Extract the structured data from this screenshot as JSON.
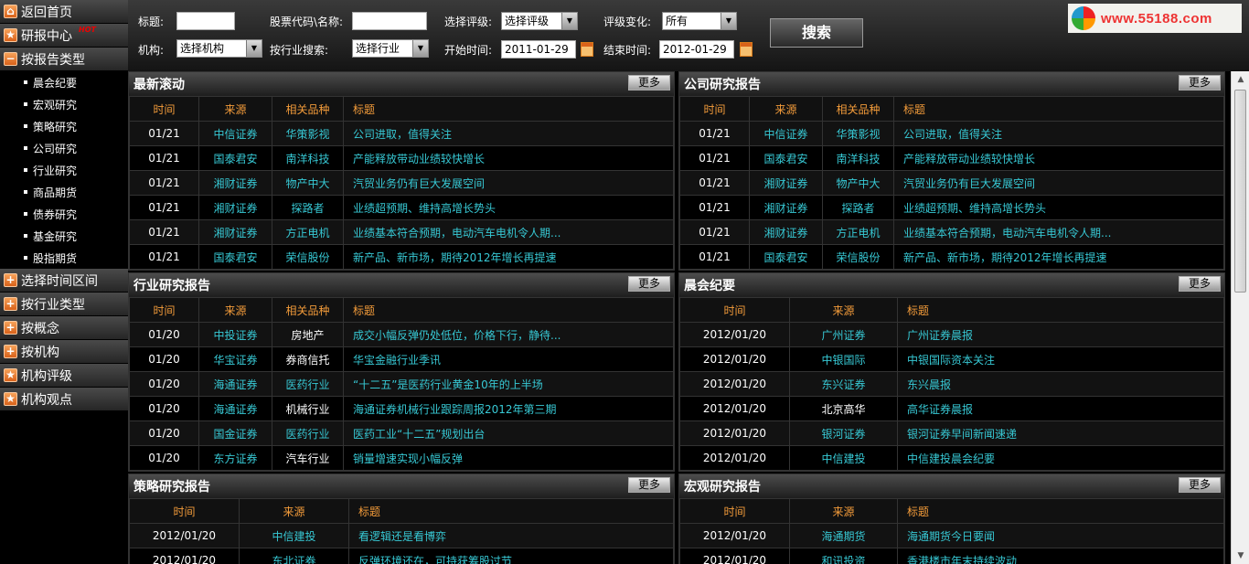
{
  "sidebar": {
    "items": [
      {
        "label": "返回首页",
        "icon": "home-icon",
        "glyph": "⌂"
      },
      {
        "label": "研报中心",
        "icon": "star-icon",
        "glyph": "★",
        "badge": "HOT"
      },
      {
        "label": "按报告类型",
        "icon": "minus-icon",
        "glyph": "−"
      }
    ],
    "sub_items": [
      "晨会纪要",
      "宏观研究",
      "策略研究",
      "公司研究",
      "行业研究",
      "商品期货",
      "债券研究",
      "基金研究",
      "股指期货"
    ],
    "items2": [
      {
        "label": "选择时间区间",
        "icon": "plus-icon",
        "glyph": "+"
      },
      {
        "label": "按行业类型",
        "icon": "plus-icon",
        "glyph": "+"
      },
      {
        "label": "按概念",
        "icon": "plus-icon",
        "glyph": "+"
      },
      {
        "label": "按机构",
        "icon": "plus-icon",
        "glyph": "+"
      },
      {
        "label": "机构评级",
        "icon": "star-icon",
        "glyph": "★"
      },
      {
        "label": "机构观点",
        "icon": "star-icon",
        "glyph": "★"
      }
    ]
  },
  "search": {
    "title_label": "标题:",
    "title_value": "",
    "code_label": "股票代码\\名称:",
    "code_value": "",
    "rating_label": "选择评级:",
    "rating_value": "选择评级",
    "change_label": "评级变化:",
    "change_value": "所有",
    "org_label": "机构:",
    "org_value": "选择机构",
    "industry_label": "按行业搜索:",
    "industry_value": "选择行业",
    "start_label": "开始时间:",
    "start_value": "2011-01-29",
    "end_label": "结束时间:",
    "end_value": "2012-01-29",
    "button": "搜索"
  },
  "logo": {
    "text": "www.55188.com"
  },
  "more_label": "更多",
  "panels": {
    "latest": {
      "title": "最新滚动",
      "headers": [
        "时间",
        "来源",
        "相关品种",
        "标题"
      ],
      "rows": [
        [
          "01/21",
          "中信证券",
          "华策影视",
          "公司进取，值得关注"
        ],
        [
          "01/21",
          "国泰君安",
          "南洋科技",
          "产能释放带动业绩较快增长"
        ],
        [
          "01/21",
          "湘财证券",
          "物产中大",
          "汽贸业务仍有巨大发展空间"
        ],
        [
          "01/21",
          "湘财证券",
          "探路者",
          "业绩超预期、维持高增长势头"
        ],
        [
          "01/21",
          "湘财证券",
          "方正电机",
          "业绩基本符合预期，电动汽车电机令人期..."
        ],
        [
          "01/21",
          "国泰君安",
          "荣信股份",
          "新产品、新市场，期待2012年增长再提速"
        ]
      ]
    },
    "company": {
      "title": "公司研究报告",
      "headers": [
        "时间",
        "来源",
        "相关品种",
        "标题"
      ],
      "rows": [
        [
          "01/21",
          "中信证券",
          "华策影视",
          "公司进取，值得关注"
        ],
        [
          "01/21",
          "国泰君安",
          "南洋科技",
          "产能释放带动业绩较快增长"
        ],
        [
          "01/21",
          "湘财证券",
          "物产中大",
          "汽贸业务仍有巨大发展空间"
        ],
        [
          "01/21",
          "湘财证券",
          "探路者",
          "业绩超预期、维持高增长势头"
        ],
        [
          "01/21",
          "湘财证券",
          "方正电机",
          "业绩基本符合预期，电动汽车电机令人期..."
        ],
        [
          "01/21",
          "国泰君安",
          "荣信股份",
          "新产品、新市场，期待2012年增长再提速"
        ]
      ]
    },
    "industry": {
      "title": "行业研究报告",
      "headers": [
        "时间",
        "来源",
        "相关品种",
        "标题"
      ],
      "rows": [
        [
          "01/20",
          "中投证券",
          "房地产",
          "成交小幅反弹仍处低位，价格下行，静待..."
        ],
        [
          "01/20",
          "华宝证券",
          "券商信托",
          "华宝金融行业季讯"
        ],
        [
          "01/20",
          "海通证券",
          "医药行业",
          "“十二五”是医药行业黄金10年的上半场"
        ],
        [
          "01/20",
          "海通证券",
          "机械行业",
          "海通证券机械行业跟踪周报2012年第三期"
        ],
        [
          "01/20",
          "国金证券",
          "医药行业",
          "医药工业“十二五”规划出台"
        ],
        [
          "01/20",
          "东方证券",
          "汽车行业",
          "销量增速实现小幅反弹"
        ]
      ]
    },
    "morning": {
      "title": "晨会纪要",
      "headers": [
        "时间",
        "来源",
        "标题"
      ],
      "rows": [
        [
          "2012/01/20",
          "广州证券",
          "广州证券晨报"
        ],
        [
          "2012/01/20",
          "中银国际",
          "中银国际资本关注"
        ],
        [
          "2012/01/20",
          "东兴证券",
          "东兴晨报"
        ],
        [
          "2012/01/20",
          "北京高华",
          "高华证券晨报"
        ],
        [
          "2012/01/20",
          "银河证券",
          "银河证券早间新闻速递"
        ],
        [
          "2012/01/20",
          "中信建投",
          "中信建投晨会纪要"
        ]
      ]
    },
    "strategy": {
      "title": "策略研究报告",
      "headers": [
        "时间",
        "来源",
        "标题"
      ],
      "rows": [
        [
          "2012/01/20",
          "中信建投",
          "看逻辑还是看博弈"
        ],
        [
          "2012/01/20",
          "东北证券",
          "反弹环境还在，可持获筹股过节"
        ]
      ]
    },
    "macro": {
      "title": "宏观研究报告",
      "headers": [
        "时间",
        "来源",
        "标题"
      ],
      "rows": [
        [
          "2012/01/20",
          "海通期货",
          "海通期货今日要闻"
        ],
        [
          "2012/01/20",
          "和讯投资",
          "香港楼市年末持续波动"
        ]
      ]
    }
  }
}
